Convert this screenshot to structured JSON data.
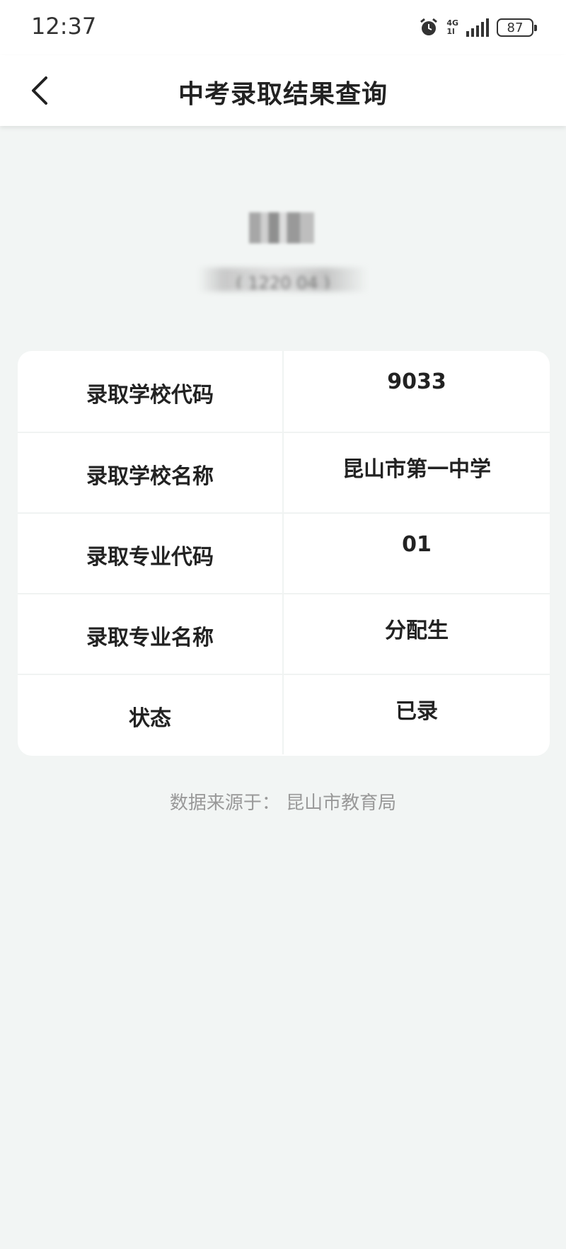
{
  "status_bar": {
    "time": "12:37",
    "network": [
      "4G",
      "1l"
    ],
    "battery": "87",
    "icons": [
      "alarm-icon",
      "signal-icon",
      "battery-icon"
    ]
  },
  "header": {
    "title": "中考录取结果查询",
    "back_icon": "chevron-left-icon"
  },
  "identity": {
    "name": "",
    "id_number": "( 1220     04 )"
  },
  "result": {
    "rows": [
      {
        "label": "录取学校代码",
        "value": "9033"
      },
      {
        "label": "录取学校名称",
        "value": "昆山市第一中学"
      },
      {
        "label": "录取专业代码",
        "value": "01"
      },
      {
        "label": "录取专业名称",
        "value": "分配生"
      },
      {
        "label": "状态",
        "value": "已录"
      }
    ]
  },
  "footer": {
    "source": "数据来源于：  昆山市教育局"
  },
  "colors": {
    "background": "#f2f5f4",
    "card": "#ffffff",
    "title": "#222222",
    "muted": "#999999"
  }
}
